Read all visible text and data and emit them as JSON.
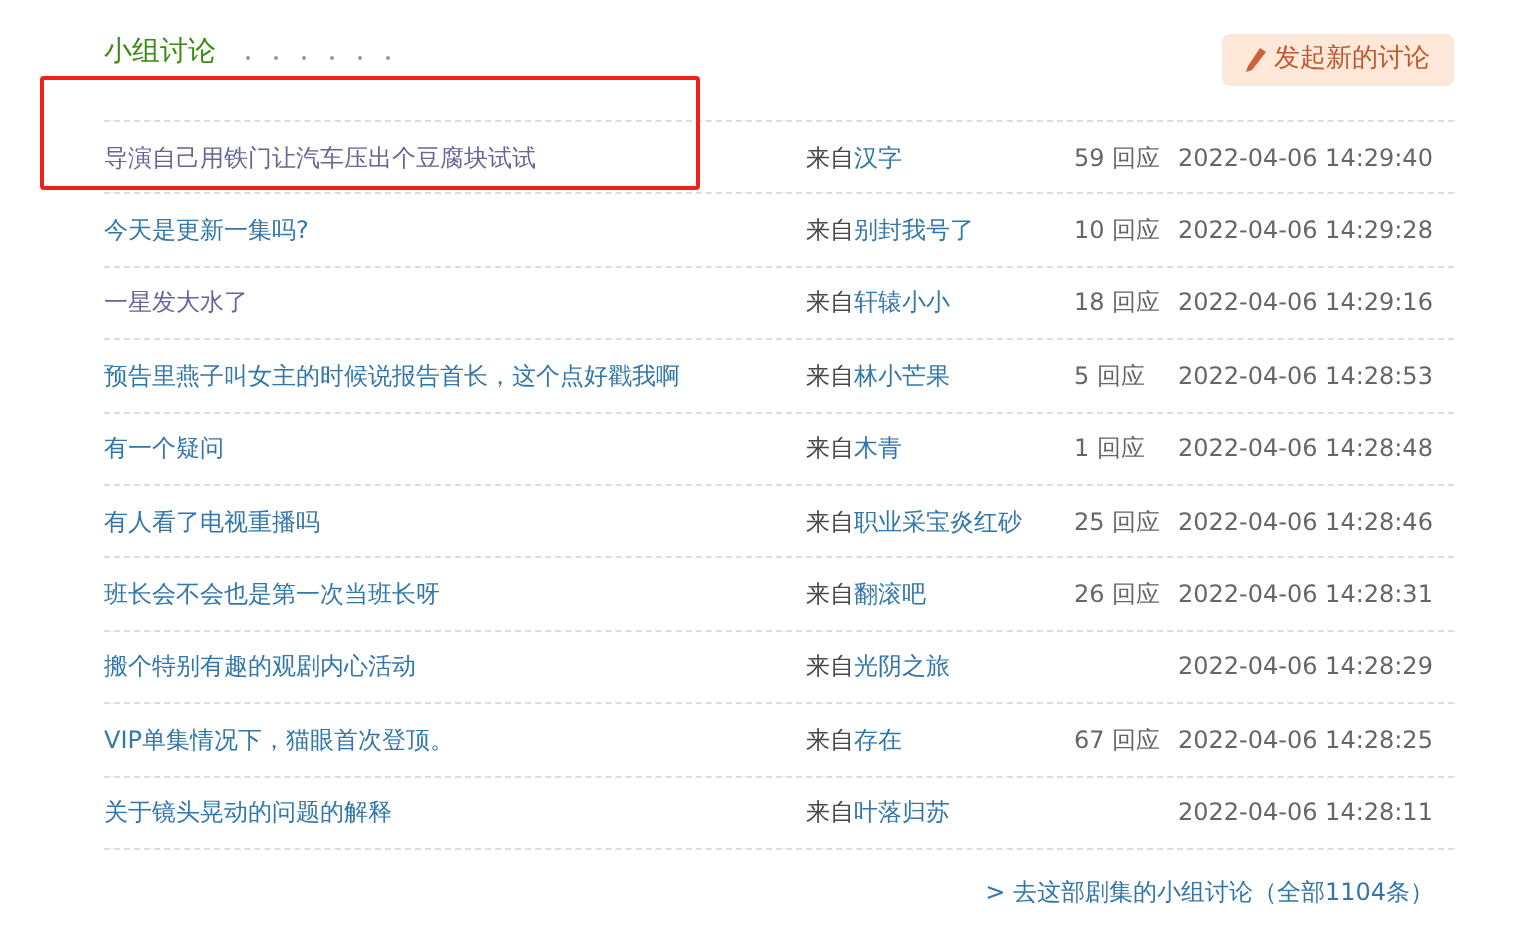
{
  "section": {
    "title": "小组讨论",
    "button": "发起新的讨论"
  },
  "topics": [
    {
      "title": "导演自己用铁门让汽车压出个豆腐块试试",
      "from": "来自",
      "group": "汉字",
      "replies": "59 回应",
      "time": "2022-04-06 14:29:40",
      "visited": true,
      "highlighted": true
    },
    {
      "title": "今天是更新一集吗?",
      "from": "来自",
      "group": "别封我号了",
      "replies": "10 回应",
      "time": "2022-04-06 14:29:28",
      "visited": false,
      "highlighted": false
    },
    {
      "title": "一星发大水了",
      "from": "来自",
      "group": "轩辕小小",
      "replies": "18 回应",
      "time": "2022-04-06 14:29:16",
      "visited": true,
      "highlighted": false
    },
    {
      "title": "预告里燕子叫女主的时候说报告首长，这个点好戳我啊",
      "from": "来自",
      "group": "林小芒果",
      "replies": "5 回应",
      "time": "2022-04-06 14:28:53",
      "visited": false,
      "highlighted": false
    },
    {
      "title": "有一个疑问",
      "from": "来自",
      "group": "木青",
      "replies": "1 回应",
      "time": "2022-04-06 14:28:48",
      "visited": false,
      "highlighted": false
    },
    {
      "title": "有人看了电视重播吗",
      "from": "来自",
      "group": "职业采宝炎红砂",
      "replies": "25 回应",
      "time": "2022-04-06 14:28:46",
      "visited": false,
      "highlighted": false
    },
    {
      "title": "班长会不会也是第一次当班长呀",
      "from": "来自",
      "group": "翻滚吧",
      "replies": "26 回应",
      "time": "2022-04-06 14:28:31",
      "visited": false,
      "highlighted": false
    },
    {
      "title": "搬个特别有趣的观剧内心活动",
      "from": "来自",
      "group": "光阴之旅",
      "time": "2022-04-06 14:28:29",
      "visited": false,
      "highlighted": false
    },
    {
      "title": "VIP单集情况下，猫眼首次登顶。",
      "from": "来自",
      "group": "存在",
      "replies": "67 回应",
      "time": "2022-04-06 14:28:25",
      "visited": false,
      "highlighted": false
    },
    {
      "title": "关于镜头晃动的问题的解释",
      "from": "来自",
      "group": "叶落归苏",
      "time": "2022-04-06 14:28:11",
      "visited": false,
      "highlighted": false
    }
  ],
  "footer_link": "> 去这部剧集的小组讨论（全部1104条）"
}
